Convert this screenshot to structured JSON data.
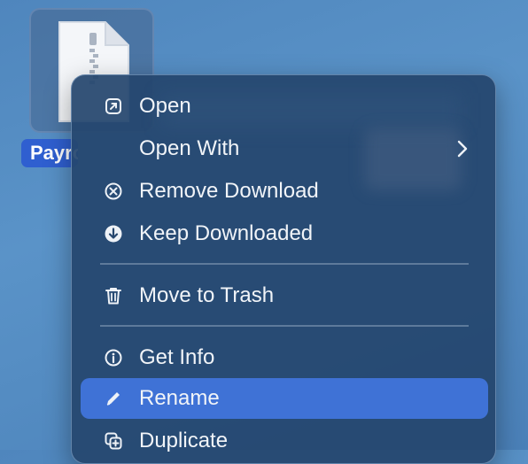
{
  "desktop": {
    "file_label": "Payroll.zip"
  },
  "menu": {
    "items": [
      {
        "label": "Open",
        "icon": "open-arrow-icon"
      },
      {
        "label": "Open With",
        "icon": "",
        "submenu": true
      },
      {
        "label": "Remove Download",
        "icon": "circle-x-icon"
      },
      {
        "label": "Keep Downloaded",
        "icon": "circle-down-arrow-icon"
      },
      {
        "label": "Move to Trash",
        "icon": "trash-icon"
      },
      {
        "label": "Get Info",
        "icon": "info-circle-icon"
      },
      {
        "label": "Rename",
        "icon": "pencil-icon",
        "selected": true
      },
      {
        "label": "Duplicate",
        "icon": "duplicate-icon"
      }
    ]
  },
  "colors": {
    "menu_background": "#25466e",
    "selection": "#3f72d6",
    "file_label_bg": "#2f5fd0",
    "text": "#f1f4f8"
  }
}
